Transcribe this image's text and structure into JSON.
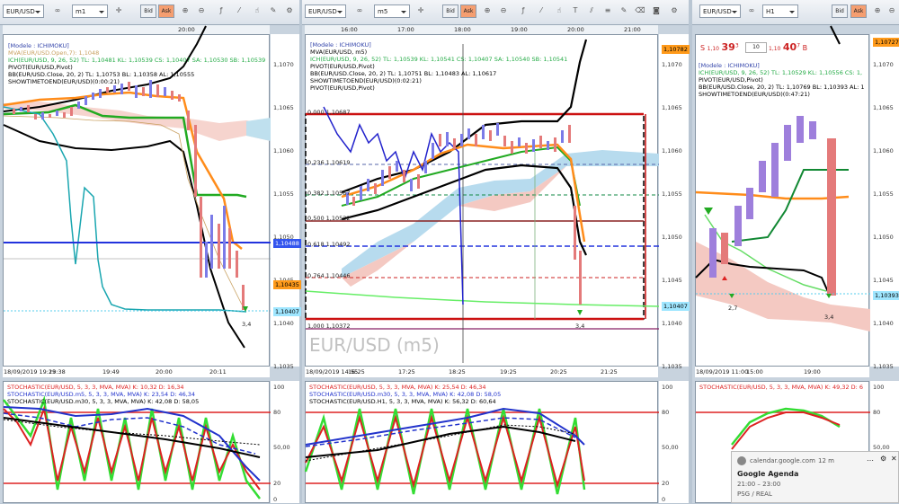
{
  "panels": [
    {
      "symbol": "EUR/USD",
      "timeframe": "m1",
      "bid_label": "Bid",
      "ask_label": "Ask",
      "top_time": "20:00",
      "price_ticks": [
        "1,1070",
        "1,1065",
        "1,1060",
        "1,1055",
        "1,1050",
        "1,1045",
        "1,1040",
        "1,1035"
      ],
      "price_tags": [
        {
          "text": "1,10488",
          "color": "#3355ee",
          "fg": "#fff"
        },
        {
          "text": "1,10435",
          "color": "#ff9a1a",
          "fg": "#000"
        },
        {
          "text": "1,10407",
          "color": "#9fe6ff",
          "fg": "#000"
        }
      ],
      "legend": [
        {
          "text": "[Modele : ICHIMOKU]",
          "color": "#3344aa"
        },
        {
          "text": "MVA(EUR/USD.Open,7): 1,1048",
          "color": "#c8a060"
        },
        {
          "text": "ICH(EUR/USD, 9, 26, 52)  TL: 1,10481  KL: 1,10539  CS: 1,10407  SA: 1,10530  SB: 1,10539",
          "color": "#22aa44"
        },
        {
          "text": "PIVOT(EUR/USD,Pivot)",
          "color": "#000"
        },
        {
          "text": "BB(EUR/USD.Close, 20, 2)  TL: 1,10753  BL: 1,10358  AL: 1,10555",
          "color": "#000"
        },
        {
          "text": "SHOWTIMETOEND(EUR/USD)(0:00:21)",
          "color": "#000"
        }
      ],
      "annot": "3,4",
      "time_axis": [
        "18/09/2019 19:23",
        "19:38",
        "19:49",
        "20:00",
        "20:11"
      ],
      "stoch_legend": [
        {
          "text": "STOCHASTIC(EUR/USD, 5, 3, 3, MVA, MVA)  K: 10,32  D: 16,34",
          "color": "#dd2222"
        },
        {
          "text": "STOCHASTIC(EUR/USD.m5, 5, 3, 3, MVA, MVA)  K: 23,54  D: 46,34",
          "color": "#2233cc"
        },
        {
          "text": "STOCHASTIC(EUR/USD.m30, 5, 3, 3, MVA, MVA)  K: 42,08  D: 58,05",
          "color": "#000"
        }
      ],
      "stoch_ticks": [
        "100",
        "80",
        "50,00",
        "20",
        "0"
      ]
    },
    {
      "symbol": "EUR/USD",
      "timeframe": "m5",
      "bid_label": "Bid",
      "ask_label": "Ask",
      "top_times": [
        "16:00",
        "17:00",
        "18:00",
        "19:00",
        "20:00",
        "21:00"
      ],
      "price_ticks": [
        "1,1070",
        "1,1065",
        "1,1060",
        "1,1055",
        "1,1050",
        "1,1045",
        "1,1040",
        "1,1035"
      ],
      "price_tags": [
        {
          "text": "1,10782",
          "color": "#ff9a1a",
          "fg": "#000"
        },
        {
          "text": "1,10407",
          "color": "#9fe6ff",
          "fg": "#000"
        }
      ],
      "legend": [
        {
          "text": "[Modele : ICHIMOKU]",
          "color": "#3344aa"
        },
        {
          "text": "MVA(EUR/USD, m5)",
          "color": "#000"
        },
        {
          "text": "ICH(EUR/USD, 9, 26, 52)  TL: 1,10539  KL: 1,10541  CS: 1,10407  SA: 1,10540  SB: 1,10541",
          "color": "#22aa44"
        },
        {
          "text": "PIVOT(EUR/USD,Pivot)",
          "color": "#000"
        },
        {
          "text": "BB(EUR/USD.Close, 20, 2)  TL: 1,10751  BL: 1,10483  AL: 1,10617",
          "color": "#000"
        },
        {
          "text": "SHOWTIMETOEND(EUR/USD)(0:02:21)",
          "color": "#000"
        },
        {
          "text": "PIVOT(EUR/USD,Pivot)",
          "color": "#000"
        }
      ],
      "fib_levels": [
        {
          "text": "0,000  1,10687"
        },
        {
          "text": "0,236  1,10619"
        },
        {
          "text": "0,382  1,10567"
        },
        {
          "text": "0,500  1,10532"
        },
        {
          "text": "0,618  1,10492"
        },
        {
          "text": "0,764  1,10446"
        },
        {
          "text": "1,000  1,10372"
        }
      ],
      "watermark": "EUR/USD (m5)",
      "annot": "3,4",
      "time_axis": [
        "18/09/2019 14:55",
        "16:25",
        "17:25",
        "18:25",
        "19:25",
        "20:25",
        "21:25"
      ],
      "stoch_legend": [
        {
          "text": "STOCHASTIC(EUR/USD, 5, 3, 3, MVA, MVA)  K: 25,54  D: 46,34",
          "color": "#dd2222"
        },
        {
          "text": "STOCHASTIC(EUR/USD.m30, 5, 3, 3, MVA, MVA)  K: 42,08  D: 58,05",
          "color": "#2233cc"
        },
        {
          "text": "STOCHASTIC(EUR/USD.H1, 5, 3, 3, MVA, MVA)  K: 56,32  D: 60,64",
          "color": "#000"
        }
      ],
      "stoch_ticks": [
        "100",
        "80",
        "50,00",
        "20",
        "0"
      ]
    },
    {
      "symbol": "EUR/USD",
      "timeframe": "H1",
      "bid_label": "Bid",
      "ask_label": "Ask",
      "price_ticks": [
        "1,1070",
        "1,1065",
        "1,1060",
        "1,1055",
        "1,1050",
        "1,1045",
        "1,1040",
        "1,1035"
      ],
      "price_tags": [
        {
          "text": "1,10727",
          "color": "#ff9a1a",
          "fg": "#000"
        },
        {
          "text": "1,10393",
          "color": "#9fe6ff",
          "fg": "#000"
        }
      ],
      "quote": {
        "sell_label": "S",
        "sell_prefix": "1,10",
        "sell_big": "39",
        "sell_sup": "3",
        "lot": "10",
        "buy_prefix": "1,10",
        "buy_big": "40",
        "buy_sup": "7",
        "buy_label": "B"
      },
      "legend": [
        {
          "text": "[Modele : ICHIMOKU]",
          "color": "#3344aa"
        },
        {
          "text": "ICH(EUR/USD, 9, 26, 52)  TL: 1,10529  KL: 1,10556  CS: 1,",
          "color": "#22aa44"
        },
        {
          "text": "PIVOT(EUR/USD,Pivot)",
          "color": "#000"
        },
        {
          "text": "BB(EUR/USD.Close, 20, 2)  TL: 1,10769  BL: 1,10393  AL: 1",
          "color": "#000"
        },
        {
          "text": "SHOWTIMETOEND(EUR/USD)(0:47:21)",
          "color": "#000"
        }
      ],
      "annots": [
        "2,7",
        "3,4"
      ],
      "time_axis": [
        "18/09/2019 11:00",
        "15:00",
        "19:00"
      ],
      "stoch_legend": [
        {
          "text": "STOCHASTIC(EUR/USD, 5, 3, 3, MVA, MVA)  K: 49,32  D: 6",
          "color": "#dd2222"
        }
      ],
      "stoch_ticks": [
        "100",
        "80",
        "50,00",
        "20"
      ]
    }
  ],
  "notification": {
    "source": "calendar.google.com",
    "age": "12 m",
    "title": "Google Agenda",
    "time": "21:00 – 23:00",
    "detail": "PSG / REAL"
  }
}
